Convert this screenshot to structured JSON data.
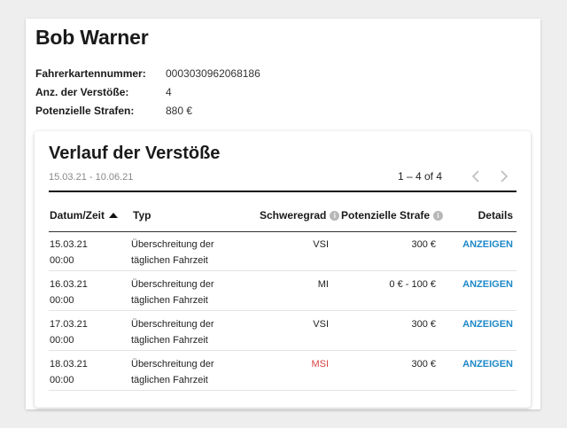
{
  "driver": {
    "name": "Bob Warner",
    "info": [
      {
        "label": "Fahrerkartennummer:",
        "value": "0003030962068186"
      },
      {
        "label": "Anz. der Verstöße:",
        "value": "4"
      },
      {
        "label": "Potenzielle Strafen:",
        "value": "880 €"
      }
    ]
  },
  "history": {
    "title": "Verlauf der Verstöße",
    "date_range": "15.03.21 - 10.06.21",
    "pagination": "1 – 4 of 4",
    "columns": {
      "date": "Datum/Zeit",
      "type": "Typ",
      "severity": "Schweregrad",
      "penalty": "Potenzielle Strafe",
      "details": "Details"
    },
    "rows": [
      {
        "date": "15.03.21",
        "time": "00:00",
        "type_line1": "Überschreitung der",
        "type_line2": "täglichen Fahrzeit",
        "severity": "VSI",
        "severity_color": "#222222",
        "penalty": "300 €",
        "details": "ANZEIGEN"
      },
      {
        "date": "16.03.21",
        "time": "00:00",
        "type_line1": "Überschreitung der",
        "type_line2": "täglichen Fahrzeit",
        "severity": "MI",
        "severity_color": "#222222",
        "penalty": "0 € - 100 €",
        "details": "ANZEIGEN"
      },
      {
        "date": "17.03.21",
        "time": "00:00",
        "type_line1": "Überschreitung der",
        "type_line2": "täglichen Fahrzeit",
        "severity": "VSI",
        "severity_color": "#222222",
        "penalty": "300 €",
        "details": "ANZEIGEN"
      },
      {
        "date": "18.03.21",
        "time": "00:00",
        "type_line1": "Überschreitung der",
        "type_line2": "täglichen Fahrzeit",
        "severity": "MSI",
        "severity_color": "#d64545",
        "penalty": "300 €",
        "details": "ANZEIGEN"
      }
    ]
  },
  "colors": {
    "accent": "#1e88c9",
    "severity_high": "#d64545"
  }
}
